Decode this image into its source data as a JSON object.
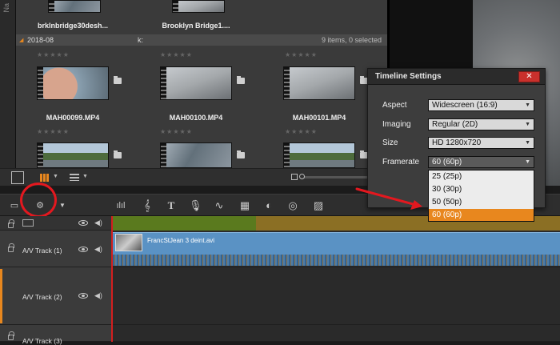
{
  "left_strip": {
    "label": "Na"
  },
  "library": {
    "top_row": [
      {
        "name": "brklnbridge30desh..."
      },
      {
        "name": "Brooklyn Bridge1...."
      }
    ],
    "group": {
      "name": "2018-08",
      "col_marker": "k:",
      "summary": "9 items, 0 selected"
    },
    "items": [
      {
        "name": "MAH00099.MP4"
      },
      {
        "name": "MAH00100.MP4"
      },
      {
        "name": "MAH00101.MP4"
      }
    ],
    "stars": "★★★★★"
  },
  "timeline": {
    "tracks": [
      {
        "name": "A/V Track (1)"
      },
      {
        "name": "A/V Track (2)"
      },
      {
        "name": "A/V Track (3)"
      }
    ],
    "clip_title": "FrancStJean 3 deint.avi"
  },
  "dialog": {
    "title": "Timeline Settings",
    "close_label": "✕",
    "rows": [
      {
        "label": "Aspect",
        "value": "Widescreen (16:9)"
      },
      {
        "label": "Imaging",
        "value": "Regular (2D)"
      },
      {
        "label": "Size",
        "value": "HD 1280x720"
      },
      {
        "label": "Framerate",
        "value": "60 (60p)"
      }
    ],
    "framerate_options": [
      "25 (25p)",
      "30 (30p)",
      "50 (50p)",
      "60 (60p)"
    ],
    "selected_option": "60 (60p)"
  },
  "colors": {
    "accent": "#e8871e",
    "annotation_red": "#e3181f",
    "clip_blue": "#5a92c4"
  }
}
